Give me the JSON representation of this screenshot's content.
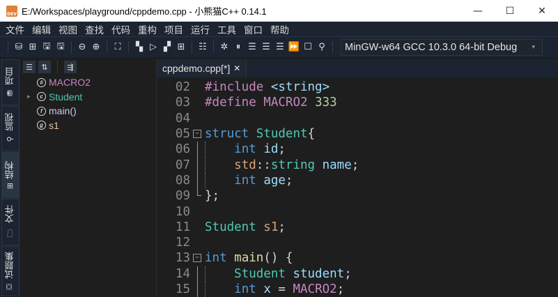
{
  "title": "E:/Workspaces/playground/cppdemo.cpp  - 小熊猫C++ 0.14.1",
  "app_icon_text": "DEV",
  "window_controls": {
    "minimize": "—",
    "maximize": "☐",
    "close": "✕"
  },
  "menu": [
    "文件",
    "编辑",
    "视图",
    "查找",
    "代码",
    "重构",
    "项目",
    "运行",
    "工具",
    "窗口",
    "帮助"
  ],
  "toolbar": {
    "groups": [
      [
        "⛁",
        "⊞",
        "🖫",
        "🖫"
      ],
      [
        "⊖",
        "⊕"
      ],
      [
        "⛶"
      ],
      [
        "▚",
        "▷",
        "▞",
        "⊞"
      ],
      [
        "☷"
      ],
      [
        "✲",
        "⏸",
        "☰",
        "☰",
        "☰",
        "⏩",
        "☐",
        "⚲"
      ]
    ],
    "compiler": "MinGW-w64 GCC 10.3.0 64-bit Debug",
    "compiler_arrow": "▾"
  },
  "side_tabs": [
    {
      "label": "项目",
      "icon": "⛃"
    },
    {
      "label": "监视",
      "icon": "⚲"
    },
    {
      "label": "结构",
      "icon": "⊞",
      "active": true
    },
    {
      "label": "文件",
      "icon": "🗀"
    },
    {
      "label": "试题集",
      "icon": "⛋"
    }
  ],
  "structure": {
    "tools": [
      "☰",
      "⇅",
      "⇶"
    ],
    "items": [
      {
        "icon": "#",
        "label": "MACRO2",
        "color": "#c586c0"
      },
      {
        "icon": "c",
        "label": "Student",
        "color": "#4ec9b0",
        "expandable": true,
        "arrow": "▸"
      },
      {
        "icon": "f",
        "label": "main()",
        "color": "#c9c9ff"
      },
      {
        "icon": "g",
        "label": "s1",
        "color": "#e8c4a0"
      }
    ]
  },
  "editor": {
    "tab_label": "cppdemo.cpp[*]",
    "tab_close": "✕",
    "lines": [
      {
        "n": "02",
        "t": [
          [
            "#include ",
            "pp"
          ],
          [
            "<string>",
            "st"
          ]
        ]
      },
      {
        "n": "03",
        "t": [
          [
            "#define ",
            "pp"
          ],
          [
            "MACRO2 ",
            "pp"
          ],
          [
            "333",
            "nu"
          ]
        ]
      },
      {
        "n": "04",
        "t": []
      },
      {
        "n": "05",
        "fold": "open",
        "t": [
          [
            "struct ",
            "kw"
          ],
          [
            "Student",
            "ty"
          ],
          [
            "{",
            "pu"
          ]
        ]
      },
      {
        "n": "06",
        "guide": true,
        "t": [
          [
            "    "
          ],
          [
            "int ",
            "kw"
          ],
          [
            "id",
            "va"
          ],
          [
            ";",
            "pu"
          ]
        ]
      },
      {
        "n": "07",
        "guide": true,
        "t": [
          [
            "    "
          ],
          [
            "std",
            "ns"
          ],
          [
            "::",
            "pu"
          ],
          [
            "string ",
            "ty"
          ],
          [
            "name",
            "va"
          ],
          [
            ";",
            "pu"
          ]
        ]
      },
      {
        "n": "08",
        "guide": true,
        "t": [
          [
            "    "
          ],
          [
            "int ",
            "kw"
          ],
          [
            "age",
            "va"
          ],
          [
            ";",
            "pu"
          ]
        ]
      },
      {
        "n": "09",
        "fold": "end",
        "t": [
          [
            "};",
            "pu"
          ]
        ]
      },
      {
        "n": "10",
        "t": []
      },
      {
        "n": "11",
        "t": [
          [
            "Student ",
            "ty"
          ],
          [
            "s1",
            "ns"
          ],
          [
            ";",
            "pu"
          ]
        ]
      },
      {
        "n": "12",
        "t": []
      },
      {
        "n": "13",
        "fold": "open",
        "t": [
          [
            "int ",
            "kw"
          ],
          [
            "main",
            "fn"
          ],
          [
            "() {",
            "pu"
          ]
        ]
      },
      {
        "n": "14",
        "guide": true,
        "t": [
          [
            "    "
          ],
          [
            "Student ",
            "ty"
          ],
          [
            "student",
            "va"
          ],
          [
            ";",
            "pu"
          ]
        ]
      },
      {
        "n": "15",
        "guide": true,
        "t": [
          [
            "    "
          ],
          [
            "int ",
            "kw"
          ],
          [
            "x ",
            "va"
          ],
          [
            "= ",
            "pu"
          ],
          [
            "MACRO2",
            "pp"
          ],
          [
            ";",
            "pu"
          ]
        ]
      }
    ]
  }
}
